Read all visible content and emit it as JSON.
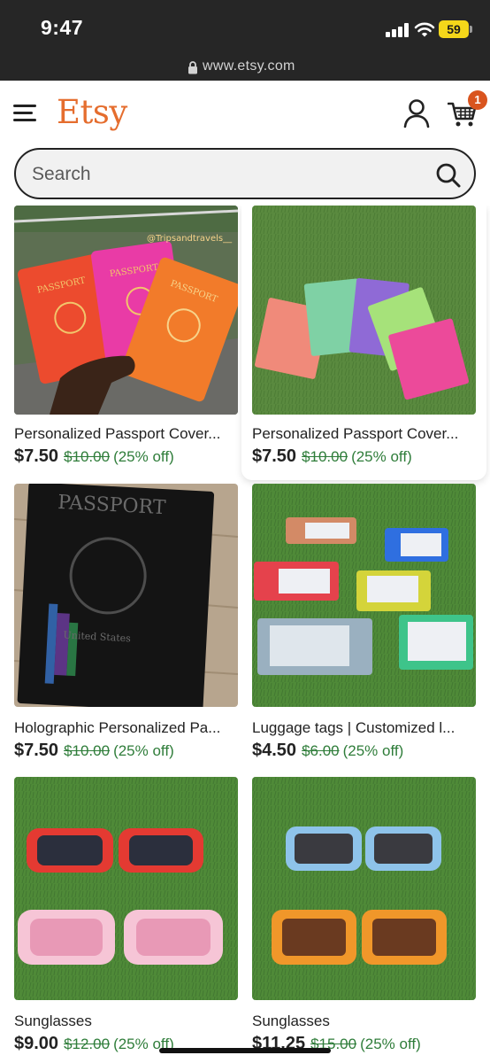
{
  "status_bar": {
    "time": "9:47",
    "battery": "59"
  },
  "browser": {
    "url": "www.etsy.com"
  },
  "header": {
    "logo": "Etsy",
    "cart_count": "1"
  },
  "search": {
    "placeholder": "Search"
  },
  "listings": [
    {
      "title": "Personalized Passport Cover...",
      "price": "$7.50",
      "original_price": "$10.00",
      "discount": "(25% off)",
      "image": "colorful-passport-covers-in-hand",
      "watermark": "@Tripsandtravels__"
    },
    {
      "title": "Personalized Passport Cover...",
      "price": "$7.50",
      "original_price": "$10.00",
      "discount": "(25% off)",
      "image": "pastel-passport-covers-on-grass"
    },
    {
      "title": "Holographic Personalized Pa...",
      "price": "$7.50",
      "original_price": "$10.00",
      "discount": "(25% off)",
      "image": "holographic-black-passport-cover"
    },
    {
      "title": "Luggage tags | Customized l...",
      "price": "$4.50",
      "original_price": "$6.00",
      "discount": "(25% off)",
      "image": "colorful-luggage-tags-on-grass"
    },
    {
      "title": "Sunglasses",
      "price": "$9.00",
      "original_price": "$12.00",
      "discount": "(25% off)",
      "image": "red-and-pink-sunglasses-on-grass"
    },
    {
      "title": "Sunglasses",
      "price": "$11.25",
      "original_price": "$15.00",
      "discount": "(25% off)",
      "image": "blue-and-orange-sunglasses-on-grass"
    }
  ],
  "colors": {
    "brand": "#e56d2e",
    "discount": "#2f7d3a",
    "cart_badge": "#d9541e"
  }
}
